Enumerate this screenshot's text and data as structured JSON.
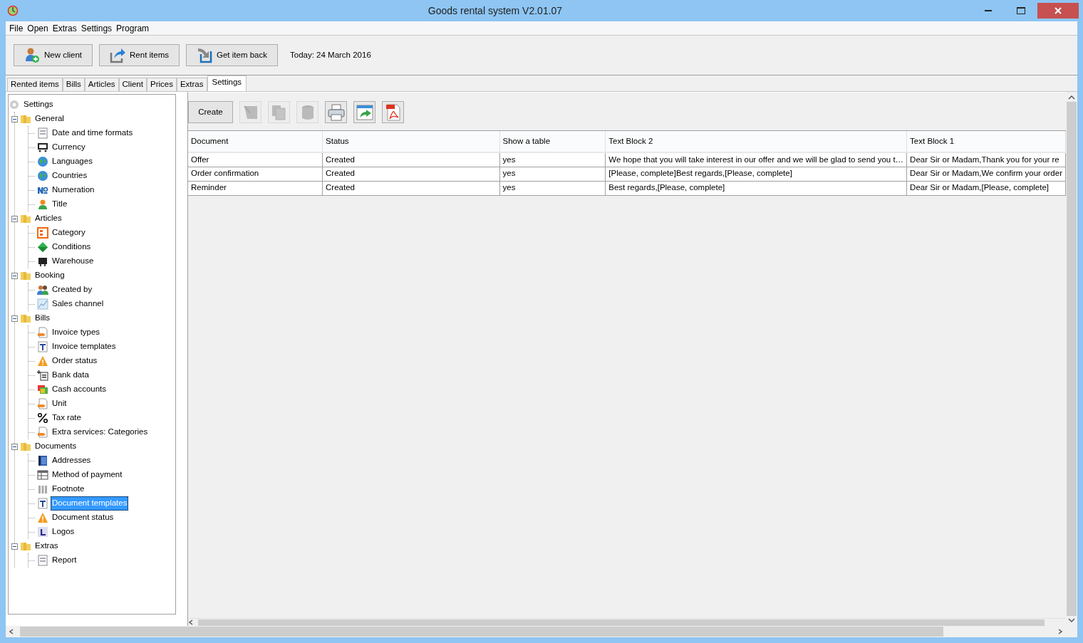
{
  "window": {
    "title": "Goods rental system V2.01.07"
  },
  "menu": [
    "File",
    "Open",
    "Extras",
    "Settings",
    "Program"
  ],
  "toolbar": {
    "buttons": [
      "New client",
      "Rent items",
      "Get item back"
    ],
    "today": "Today: 24 March 2016"
  },
  "tabs": [
    {
      "label": "Rented items",
      "selected": false
    },
    {
      "label": "Bills",
      "selected": false
    },
    {
      "label": "Articles",
      "selected": false
    },
    {
      "label": "Client",
      "selected": false
    },
    {
      "label": "Prices",
      "selected": false
    },
    {
      "label": "Extras",
      "selected": false
    },
    {
      "label": "Settings",
      "selected": true
    }
  ],
  "tree": {
    "label": "Settings",
    "children": [
      {
        "label": "General",
        "expanded": true,
        "children": [
          {
            "label": "Date and time formats",
            "selected": false
          },
          {
            "label": "Currency",
            "selected": false
          },
          {
            "label": "Languages",
            "selected": false
          },
          {
            "label": "Countries",
            "selected": false
          },
          {
            "label": "Numeration",
            "selected": false
          },
          {
            "label": "Title",
            "selected": false
          }
        ]
      },
      {
        "label": "Articles",
        "expanded": true,
        "children": [
          {
            "label": "Category",
            "selected": false
          },
          {
            "label": "Conditions",
            "selected": false
          },
          {
            "label": "Warehouse",
            "selected": false
          }
        ]
      },
      {
        "label": "Booking",
        "expanded": true,
        "children": [
          {
            "label": "Created by",
            "selected": false
          },
          {
            "label": "Sales channel",
            "selected": false
          }
        ]
      },
      {
        "label": "Bills",
        "expanded": true,
        "children": [
          {
            "label": "Invoice types",
            "selected": false
          },
          {
            "label": "Invoice templates",
            "selected": false
          },
          {
            "label": "Order status",
            "selected": false
          },
          {
            "label": "Bank data",
            "selected": false
          },
          {
            "label": "Cash accounts",
            "selected": false
          },
          {
            "label": "Unit",
            "selected": false
          },
          {
            "label": "Tax rate",
            "selected": false
          },
          {
            "label": "Extra services: Categories",
            "selected": false
          }
        ]
      },
      {
        "label": "Documents",
        "expanded": true,
        "children": [
          {
            "label": "Addresses",
            "selected": false
          },
          {
            "label": "Method of payment",
            "selected": false
          },
          {
            "label": "Footnote",
            "selected": false
          },
          {
            "label": "Document templates",
            "selected": true
          },
          {
            "label": "Document status",
            "selected": false
          },
          {
            "label": "Logos",
            "selected": false
          }
        ]
      },
      {
        "label": "Extras",
        "expanded": true,
        "children": [
          {
            "label": "Report",
            "selected": false
          }
        ]
      }
    ]
  },
  "actions": {
    "create": "Create",
    "icon_buttons": [
      {
        "disabled": true
      },
      {
        "disabled": true
      },
      {
        "disabled": true
      },
      {
        "disabled": false
      },
      {
        "disabled": false
      },
      {
        "disabled": false
      }
    ]
  },
  "table": {
    "columns": [
      "Document",
      "Status",
      "Show a table",
      "Text Block 2",
      "Text Block 1"
    ],
    "rows": [
      [
        "Offer",
        "Created",
        "yes",
        "We hope that you will take interest in our offer and we will be glad to send you t…",
        "Dear Sir or Madam,Thank you for your re"
      ],
      [
        "Order confirmation",
        "Created",
        "yes",
        "[Please, complete]Best regards,[Please, complete]",
        "Dear Sir or Madam,We confirm your order"
      ],
      [
        "Reminder",
        "Created",
        "yes",
        "Best regards,[Please, complete]",
        "Dear Sir or Madam,[Please, complete]"
      ]
    ]
  }
}
